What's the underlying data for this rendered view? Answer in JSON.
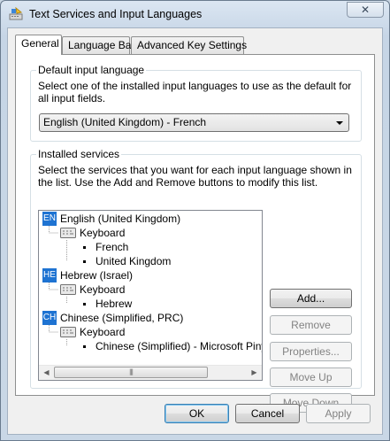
{
  "window": {
    "title": "Text Services and Input Languages",
    "close_symbol": "✕"
  },
  "tabs": [
    {
      "label": "General",
      "active": true
    },
    {
      "label": "Language Bar",
      "active": false
    },
    {
      "label": "Advanced Key Settings",
      "active": false
    }
  ],
  "default_input": {
    "group_label": "Default input language",
    "description": "Select one of the installed input languages to use as the default for all input fields.",
    "selected_value": "English (United Kingdom) - French"
  },
  "installed_services": {
    "group_label": "Installed services",
    "description": "Select the services that you want for each input language shown in the list. Use the Add and Remove buttons to modify this list.",
    "languages": [
      {
        "code": "EN",
        "name": "English (United Kingdom)",
        "category": "Keyboard",
        "items": [
          "French",
          "United Kingdom"
        ]
      },
      {
        "code": "HE",
        "name": "Hebrew (Israel)",
        "category": "Keyboard",
        "items": [
          "Hebrew"
        ]
      },
      {
        "code": "CH",
        "name": "Chinese (Simplified, PRC)",
        "category": "Keyboard",
        "items": [
          "Chinese (Simplified) - Microsoft Pinyin Ne"
        ]
      }
    ],
    "scrollbar": {
      "left_arrow": "◀",
      "right_arrow": "▶",
      "thumb_grip": "|||"
    },
    "buttons": {
      "add": "Add...",
      "remove": "Remove",
      "properties": "Properties...",
      "move_up": "Move Up",
      "move_down": "Move Down"
    }
  },
  "dialog_buttons": {
    "ok": "OK",
    "cancel": "Cancel",
    "apply": "Apply"
  },
  "icons": {
    "title": "text-services-icon",
    "keyboard": "keyboard-icon"
  },
  "colors": {
    "language_badge": "#1e73d2"
  }
}
